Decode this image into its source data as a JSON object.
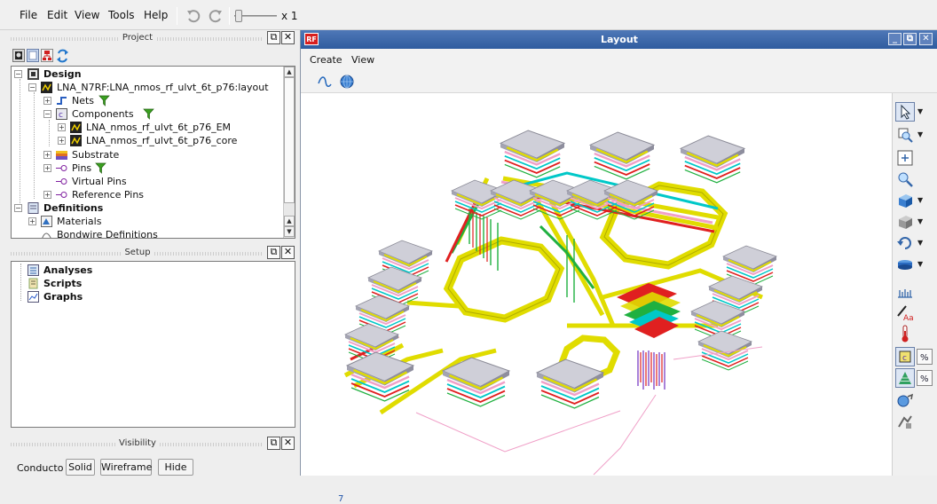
{
  "menu": {
    "file": "File",
    "edit": "Edit",
    "view": "View",
    "tools": "Tools",
    "help": "Help"
  },
  "zoom": {
    "label": "x 1"
  },
  "project_panel": {
    "title": "Project",
    "tree": {
      "design": "Design",
      "cell": "LNA_N7RF:LNA_nmos_rf_ulvt_6t_p76:layout",
      "nets": "Nets",
      "components": "Components",
      "component_em": "LNA_nmos_rf_ulvt_6t_p76_EM",
      "component_core": "LNA_nmos_rf_ulvt_6t_p76_core",
      "substrate": "Substrate",
      "pins": "Pins",
      "virtual_pins": "Virtual Pins",
      "reference_pins": "Reference Pins",
      "definitions": "Definitions",
      "materials": "Materials",
      "bondwire_definitions": "Bondwire Definitions"
    }
  },
  "setup_panel": {
    "title": "Setup",
    "items": {
      "analyses": "Analyses",
      "scripts": "Scripts",
      "graphs": "Graphs"
    }
  },
  "visibility_panel": {
    "title": "Visibility",
    "buttons": {
      "conductor": "Conducto",
      "solid": "Solid",
      "wireframe": "Wireframe",
      "hide": "Hide"
    }
  },
  "layout_window": {
    "title": "Layout",
    "logo": "RF",
    "menu": {
      "create": "Create",
      "view": "View"
    },
    "axis_label": "7"
  },
  "icons": [
    "undo-icon",
    "redo-icon",
    "filter-icon",
    "design-icon",
    "cell-icon",
    "nets-icon",
    "components-icon",
    "substrate-icon",
    "pin-icon",
    "materials-icon",
    "select-arrow-icon",
    "zoom-icon",
    "fit-icon",
    "view-3d-icon",
    "thermometer-icon",
    "percent-icon"
  ],
  "colors": {
    "titlebar": "#3a66a8",
    "trace_yellow": "#e0dc00",
    "pad_gray": "#c8c8d0",
    "layer_pink": "#f0a0c8",
    "layer_red": "#e02020",
    "layer_cyan": "#00c8c8",
    "layer_green": "#20b040"
  }
}
